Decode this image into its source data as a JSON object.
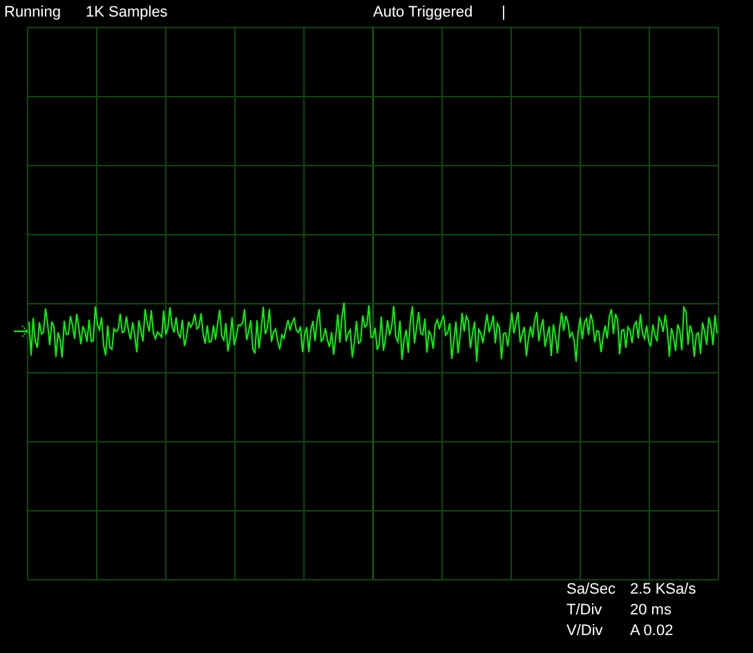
{
  "status_bar": {
    "status": "Running",
    "samples": "1K Samples",
    "trigger_mode": "Auto Triggered",
    "trigger_marker": "|"
  },
  "readings": [
    {
      "label": "Sa/Sec",
      "value": "2.5 KSa/s"
    },
    {
      "label": "T/Div",
      "value": "20 ms"
    },
    {
      "label": "V/Div",
      "value": "A 0.02"
    }
  ]
}
